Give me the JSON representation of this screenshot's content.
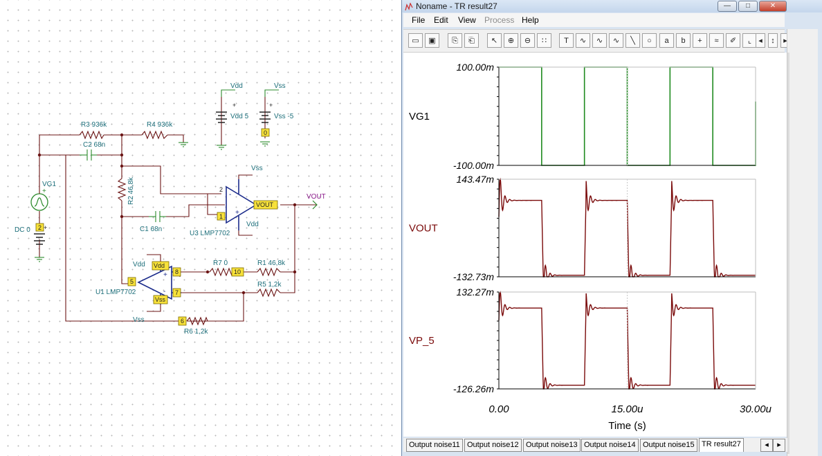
{
  "schematic": {
    "components": {
      "r3": "R3 936k",
      "r4": "R4 936k",
      "c2": "C2 68n",
      "r2": "R2 46,8k",
      "c1": "C1 68n",
      "vg1": "VG1",
      "dc0": "DC 0",
      "vdd_src": "Vdd 5",
      "vss_src": "Vss -5",
      "u3": "U3 LMP7702",
      "u1": "U1 LMP7702",
      "r7": "R7 0",
      "r1": "R1 46,8k",
      "r5": "R5 1,2k",
      "r6": "R6 1,2k"
    },
    "nets": {
      "vdd": "Vdd",
      "vss": "Vss",
      "vout": "VOUT"
    },
    "pins": {
      "p2": "2",
      "p1": "1",
      "p5": "5",
      "p8": "8",
      "p7": "7",
      "p10": "10",
      "p6": "6",
      "p0": "0",
      "pin_minus": "2",
      "pin_plus": "1"
    },
    "symbols": {
      "plus": "+",
      "minus": "-"
    }
  },
  "window": {
    "title": "Noname - TR result27",
    "controls": {
      "minimize": "—",
      "maximize": "□",
      "close": "✕"
    },
    "menu": [
      "File",
      "Edit",
      "View",
      "Process",
      "Help"
    ]
  },
  "toolbar": {
    "icons": [
      "open-icon",
      "save-icon",
      "copy-icon",
      "paste-icon",
      "pointer-icon",
      "zoom-in-icon",
      "zoom-out-icon",
      "grid-icon",
      "text-icon",
      "curve-a-icon",
      "curve-b-icon",
      "curve-c-icon",
      "line-icon",
      "circle-icon",
      "cursor-a-icon",
      "cursor-b-icon",
      "marker-icon",
      "style-icon",
      "pen-icon",
      "angle-icon",
      "left-arrow-icon",
      "updown-icon",
      "right-arrow-icon"
    ]
  },
  "plot": {
    "colors": {
      "vg1": "#1e8a1e",
      "vout": "#7a0a0a",
      "vp5": "#7a0a0a"
    },
    "x_axis": {
      "label": "Time (s)",
      "ticks": [
        "0.00",
        "15.00u",
        "30.00u"
      ]
    },
    "panels": [
      {
        "name": "VG1",
        "ymax": "100.00m",
        "ymin": "-100.00m"
      },
      {
        "name": "VOUT",
        "ymax": "143.47m",
        "ymin": "-132.73m"
      },
      {
        "name": "VP_5",
        "ymax": "132.27m",
        "ymin": "-126.26m"
      }
    ]
  },
  "tabs": [
    "Output noise11",
    "Output noise12",
    "Output noise13",
    "Output noise14",
    "Output noise15",
    "TR result27"
  ],
  "tab_nav": {
    "prev": "◂",
    "next": "▸"
  },
  "chart_data": {
    "type": "line",
    "xlabel": "Time (s)",
    "x_unit": "s",
    "xlim": [
      0,
      3e-05
    ],
    "series": [
      {
        "name": "VG1",
        "period": 1e-05,
        "duty": 0.5,
        "high": 0.1,
        "low": -0.1,
        "ylim": [
          -0.1,
          0.1
        ]
      },
      {
        "name": "VOUT",
        "high": 0.0835,
        "low": -0.1285,
        "overshoot": 0.143,
        "ylim": [
          -0.13273,
          0.14347
        ]
      },
      {
        "name": "VP_5",
        "high": 0.0895,
        "low": -0.1165,
        "overshoot": 0.132,
        "ylim": [
          -0.12626,
          0.13227
        ]
      }
    ],
    "grid": false
  }
}
